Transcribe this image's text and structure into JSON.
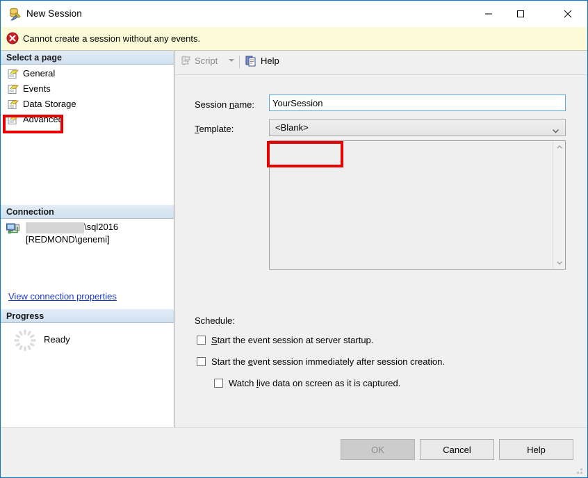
{
  "window": {
    "title": "New Session",
    "icon": "session-database-tools-icon",
    "accent_color": "#0078d7",
    "controls": {
      "minimize": "minimize-icon",
      "maximize": "maximize-icon",
      "close": "close-icon"
    }
  },
  "error_banner": {
    "icon": "error-circle-icon",
    "message": "Cannot create a session without any events.",
    "background": "#fbfbd8"
  },
  "sidebar": {
    "select_page_header": "Select a page",
    "items": [
      {
        "label": "General",
        "icon": "page-general-icon",
        "selected": true
      },
      {
        "label": "Events",
        "icon": "page-events-icon",
        "selected": false
      },
      {
        "label": "Data Storage",
        "icon": "page-data-storage-icon",
        "selected": false
      },
      {
        "label": "Advanced",
        "icon": "page-advanced-icon",
        "selected": false
      }
    ],
    "connection": {
      "header": "Connection",
      "icon": "server-connection-icon",
      "server_redacted": true,
      "server": "\\sql2016",
      "user": "[REDMOND\\genemi]",
      "link": "View connection properties"
    },
    "progress": {
      "header": "Progress",
      "icon": "spinner-icon",
      "status": "Ready"
    }
  },
  "toolbar": {
    "script": {
      "label": "Script",
      "icon": "script-icon",
      "disabled": true,
      "dropdown_icon": "chevron-down-icon"
    },
    "help": {
      "label": "Help",
      "icon": "help-pages-icon"
    }
  },
  "form": {
    "session_name": {
      "label_prefix": "Session ",
      "label_accel": "n",
      "label_suffix": "ame:",
      "value": "YourSession",
      "placeholder": ""
    },
    "template": {
      "label_accel": "T",
      "label_suffix": "emplate:",
      "value": "<Blank>",
      "options": [
        "<Blank>"
      ],
      "arrow_icon": "chevron-down-icon"
    },
    "description": {
      "value": "",
      "scrollbar": {
        "up_icon": "chevron-up-icon",
        "down_icon": "chevron-down-icon"
      }
    },
    "schedule": {
      "label": "Schedule:",
      "checkboxes": [
        {
          "pre": "",
          "accel": "S",
          "post": "tart the event session at server startup.",
          "checked": false
        },
        {
          "pre": "Start the ",
          "accel": "e",
          "post": "vent session immediately after session creation.",
          "checked": false
        },
        {
          "pre": "Watch ",
          "accel": "l",
          "post": "ive data on screen as it is captured.",
          "checked": false
        }
      ]
    }
  },
  "footer": {
    "ok": {
      "label": "OK",
      "disabled": true
    },
    "cancel": {
      "label": "Cancel",
      "disabled": false
    },
    "help": {
      "label": "Help",
      "disabled": false
    },
    "resize_grip_icon": "resize-grip-icon"
  },
  "annotations": {
    "color": "#e60000",
    "boxes": [
      "general-sidebar-item",
      "session-name-field"
    ]
  }
}
